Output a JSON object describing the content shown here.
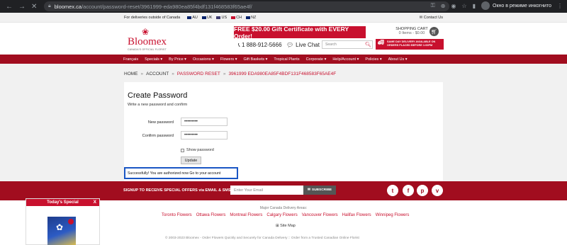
{
  "browser": {
    "url_host": "bloomex.ca",
    "url_path": "/account/password-reset/3961999-eda980ea85f4bdf131f468583f65ae4f/",
    "incognito_label": "Окно в режиме инкогнито"
  },
  "topbar": {
    "deliveries_text": "For deliveries outside of Canada",
    "flags": [
      "AU",
      "UK",
      "US",
      "CH",
      "NZ"
    ],
    "contact": "Contact Us"
  },
  "header": {
    "logo_name": "Bloomex",
    "logo_tagline": "CANADA'S OFFICIAL FLORIST",
    "promo": "FREE $20.00 Gift Certificate with EVERY Order!",
    "phone": "1 888-912-5666",
    "live_chat": "Live Chat",
    "search_placeholder": "Search",
    "cart_title": "SHOPPING CART",
    "cart_items": "0 Items - $0.00",
    "same_day_line1": "SAME DAY DELIVERY AVAILABLE ON",
    "same_day_line2": "ORDERS PLACED BEFORE 1:00PM"
  },
  "nav": {
    "items": [
      "Français",
      "Specials ▾",
      "By Price ▾",
      "Occasions ▾",
      "Flowers ▾",
      "Gift Baskets ▾",
      "Tropical Plants",
      "Corporate ▾",
      "Help/Account ▾",
      "Policies ▾",
      "About Us ▾"
    ]
  },
  "breadcrumb": {
    "home": "HOME",
    "account": "ACCOUNT",
    "reset": "PASSWORD RESET",
    "token": "3961999 EDA980EA85F4BDF131F468583F65AE4F",
    "sep": "»"
  },
  "form": {
    "title": "Create Password",
    "intro": "Write a new password and confirm",
    "new_password_label": "New password",
    "new_password_value": "•••••••••",
    "confirm_password_label": "Confirm password",
    "confirm_password_value": "•••••••••",
    "show_password_label": "Show password",
    "update_button": "Update",
    "success_message": "Successfully! You are authorized now Go to your account"
  },
  "signup": {
    "text": "SIGNUP TO RECEIVE SPECIAL OFFERS via EMAIL & SMS",
    "email_placeholder": "Enter Your Email",
    "subscribe": "SUBSCRIBE",
    "social_icons": [
      "twitter-icon",
      "facebook-icon",
      "pinterest-icon",
      "vk-icon"
    ]
  },
  "footer": {
    "major": "Major Canada Delivery Areas:",
    "cities": [
      "Toronto Flowers",
      "Ottawa Flowers",
      "Montreal Flowers",
      "Calgary Flowers",
      "Vancouver Flowers",
      "Halifax Flowers",
      "Winnipeg Flowers"
    ],
    "sitemap": "Site Map",
    "copyright": "© 2003-2023 Bloomex - Order Flowers Quickly and Securely for Canada Delivery :: Order from a Trusted Canadian Online Florist"
  },
  "special": {
    "title": "Today's Special",
    "close": "X"
  },
  "colors": {
    "brand_red": "#c8102e",
    "nav_red": "#a10d1f",
    "highlight_blue": "#1a56c4"
  }
}
